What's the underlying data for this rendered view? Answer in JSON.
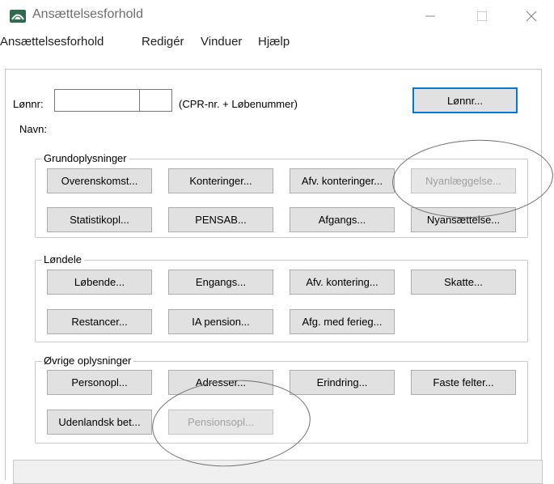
{
  "window": {
    "title": "Ansættelsesforhold",
    "icon": "app-logo-icon",
    "controls": [
      "minimize-icon",
      "maximize-icon",
      "close-icon"
    ]
  },
  "menu": {
    "items": [
      "Ansættelsesforhold",
      "Redigér",
      "Vinduer",
      "Hjælp"
    ]
  },
  "form": {
    "lonnr_label": "Lønnr:",
    "cpr_value": "",
    "seq_value": "",
    "hint": "(CPR-nr. + Løbenummer)",
    "lonnr_button": "Lønnr...",
    "navn_label": "Navn:"
  },
  "groups": {
    "grund": {
      "title": "Grundoplysninger",
      "buttons": [
        "Overenskomst...",
        "Konteringer...",
        "Afv. konteringer...",
        "Nyanlæggelse...",
        "Statistikopl...",
        "PENSAB...",
        "Afgangs...",
        "Nyansættelse..."
      ]
    },
    "lon": {
      "title": "Løndele",
      "buttons": [
        "Løbende...",
        "Engangs...",
        "Afv. kontering...",
        "Skatte...",
        "Restancer...",
        "IA pension...",
        "Afg. med ferieg..."
      ]
    },
    "ovrige": {
      "title": "Øvrige oplysninger",
      "buttons": [
        "Personopl...",
        "Adresser...",
        "Erindring...",
        "Faste felter...",
        "Udenlandsk bet...",
        "Pensionsopl..."
      ]
    }
  },
  "colors": {
    "default_button_border": "#0078d7",
    "disabled_text": "#a0a0a0",
    "app_icon_bg": "#2e6b4f"
  }
}
